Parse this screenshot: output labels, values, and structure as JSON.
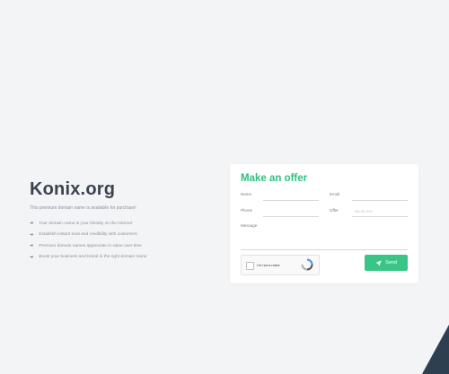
{
  "domain": {
    "name": "Konix.org",
    "subtitle": "This premium domain name is available for purchase!"
  },
  "features": [
    "Your domain name is your identity on the internet",
    "Establish instant trust and credibility with customers",
    "Premium domain names appreciate in value over time",
    "Boost your business and brand in the right domain name"
  ],
  "offer_form": {
    "title": "Make an offer",
    "name_label": "Name",
    "email_label": "Email",
    "phone_label": "Phone",
    "offer_label": "Offer",
    "offer_placeholder": "Min $1,500",
    "message_label": "Message",
    "recaptcha_label": "I'm not a robot",
    "send_label": "Send"
  },
  "colors": {
    "accent": "#2ec27e",
    "button": "#39c585",
    "corner_shape": "#2f3f52"
  },
  "icons": [
    "arrow-right-icon",
    "send-icon",
    "recaptcha-icon",
    "checkbox-icon"
  ]
}
